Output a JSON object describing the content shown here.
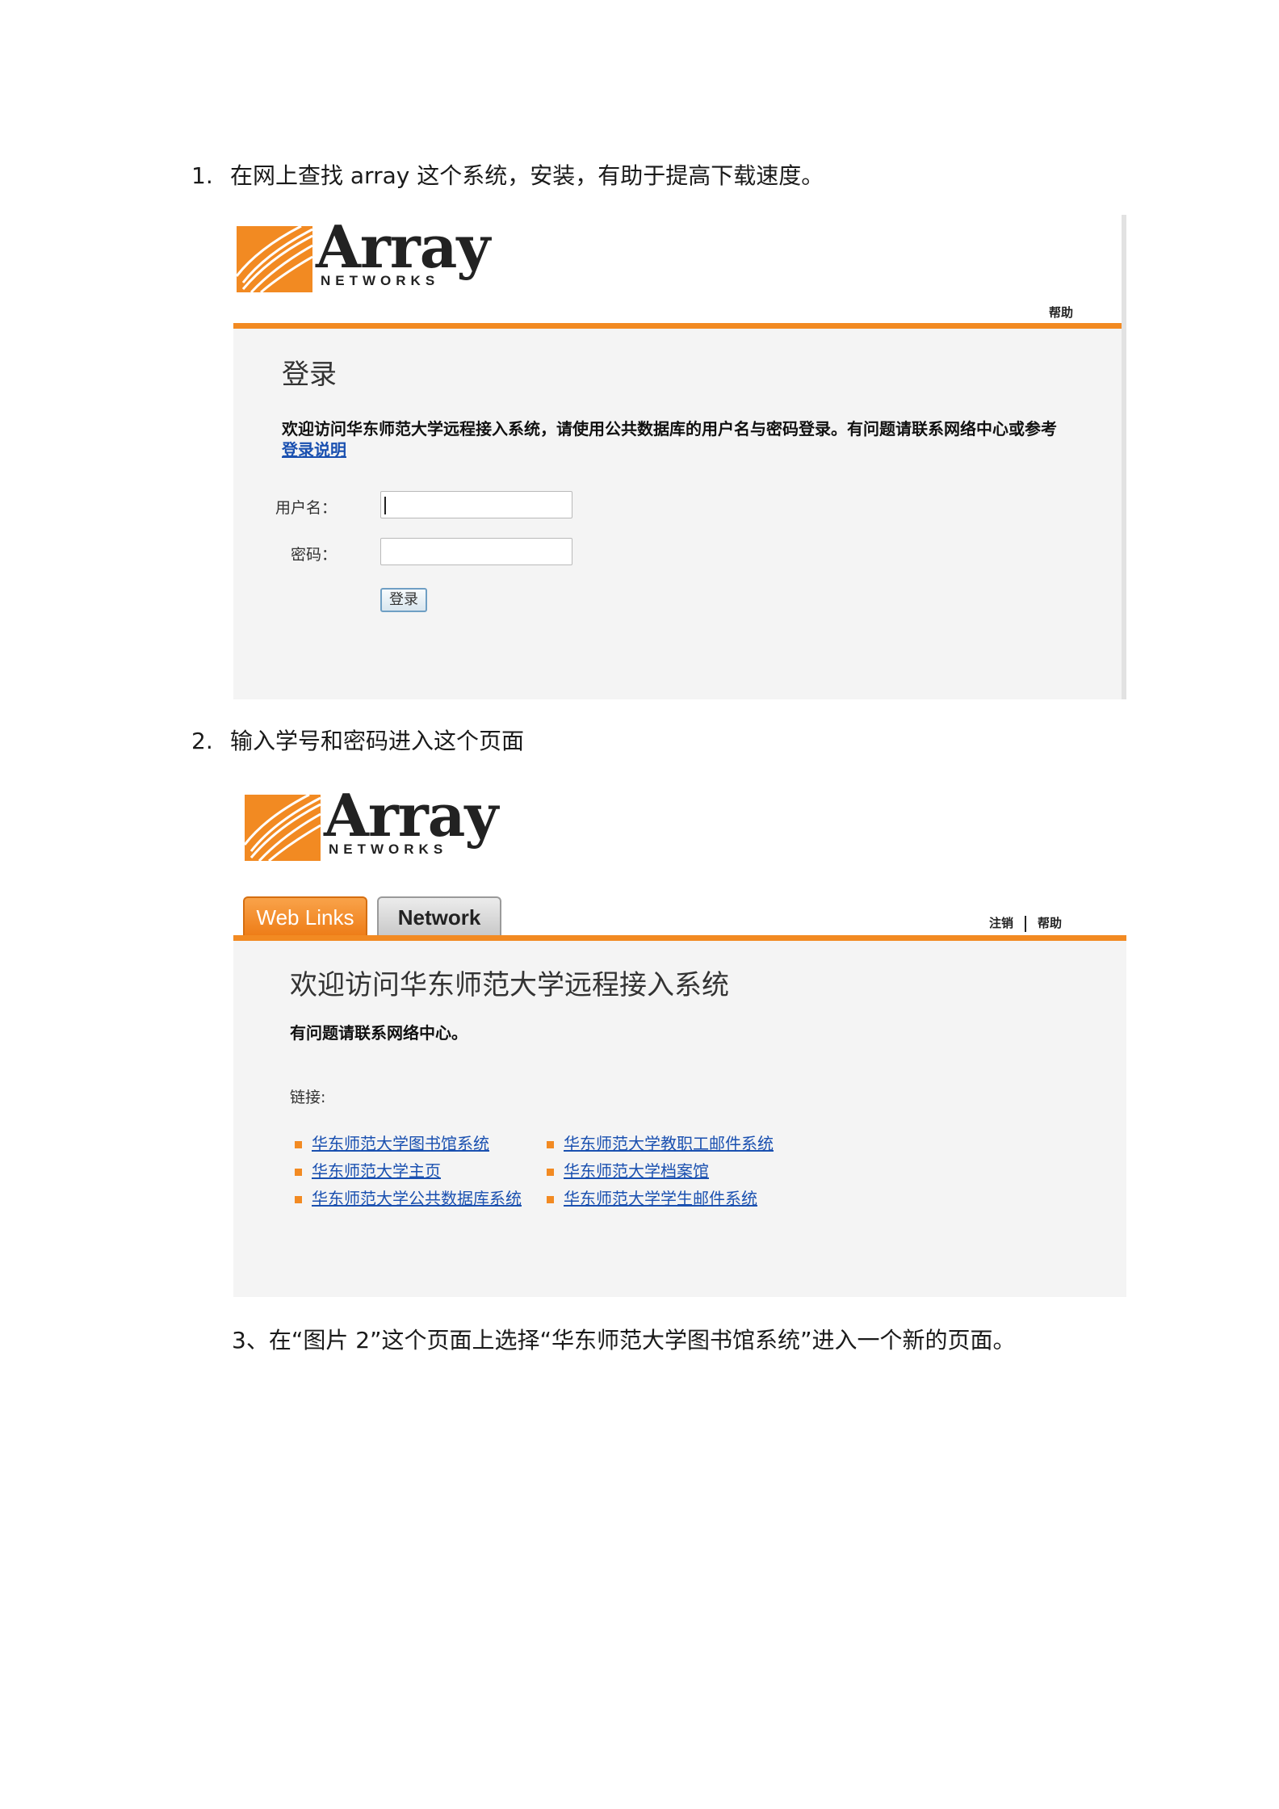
{
  "steps": [
    {
      "num": "1.",
      "text": "在网上查找 array 这个系统，安装，有助于提高下载速度。"
    },
    {
      "num": "2.",
      "text": "输入学号和密码进入这个页面"
    },
    {
      "num": "",
      "text": "3、在“图片 2”这个页面上选择“华东师范大学图书馆系统”进入一个新的页面。"
    }
  ],
  "logo": {
    "word": "Array",
    "sub": "NETWORKS",
    "brand_color": "#f28a22"
  },
  "login": {
    "help": "帮助",
    "title": "登录",
    "welcome": "欢迎访问华东师范大学远程接入系统，请使用公共数据库的用户名与密码登录。有问题请联系网络中心或参考",
    "guide_link": "登录说明",
    "username_label": "用户名：",
    "password_label": "密码：",
    "username_value": "",
    "password_value": "",
    "submit": "登录"
  },
  "portal": {
    "tabs": [
      {
        "label": "Web Links",
        "active": true
      },
      {
        "label": "Network",
        "active": false
      }
    ],
    "logout": "注销",
    "help": "帮助",
    "title": "欢迎访问华东师范大学远程接入系统",
    "notice": "有问题请联系网络中心。",
    "links_label": "链接:",
    "links": [
      "华东师范大学图书馆系统",
      "华东师范大学教职工邮件系统",
      "华东师范大学主页",
      "华东师范大学档案馆",
      "华东师范大学公共数据库系统",
      "华东师范大学学生邮件系统"
    ]
  }
}
